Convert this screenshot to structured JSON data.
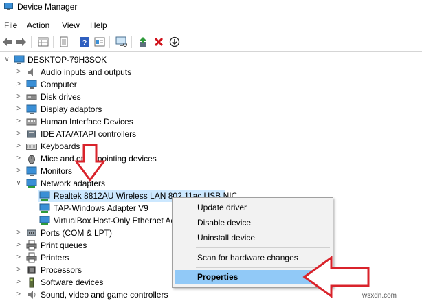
{
  "window": {
    "title": "Device Manager"
  },
  "menu": [
    "File",
    "Action",
    "View",
    "Help"
  ],
  "toolbar": {
    "icons": [
      "back-arrow-icon",
      "forward-arrow-icon",
      "properties-grid-icon",
      "update-list-icon",
      "help-icon",
      "device-details-icon",
      "monitor-scan-icon",
      "update-driver-icon",
      "uninstall-x-icon",
      "disable-download-icon"
    ]
  },
  "tree": {
    "root": "DESKTOP-79H3SOK",
    "items": [
      {
        "label": "Audio inputs and outputs",
        "icon": "speaker-icon",
        "expanded": false
      },
      {
        "label": "Computer",
        "icon": "computer-icon",
        "expanded": false
      },
      {
        "label": "Disk drives",
        "icon": "disk-drive-icon",
        "expanded": false
      },
      {
        "label": "Display adaptors",
        "icon": "display-adapter-icon",
        "expanded": false
      },
      {
        "label": "Human Interface Devices",
        "icon": "hid-icon",
        "expanded": false
      },
      {
        "label": "IDE ATA/ATAPI controllers",
        "icon": "ide-controller-icon",
        "expanded": false
      },
      {
        "label": "Keyboards",
        "icon": "keyboard-icon",
        "expanded": false
      },
      {
        "label": "Mice and other pointing devices",
        "icon": "mouse-icon",
        "expanded": false
      },
      {
        "label": "Monitors",
        "icon": "monitor-icon",
        "expanded": false
      },
      {
        "label": "Network adapters",
        "icon": "network-adapter-icon",
        "expanded": true
      },
      {
        "label": "Ports (COM & LPT)",
        "icon": "port-icon",
        "expanded": false
      },
      {
        "label": "Print queues",
        "icon": "print-queue-icon",
        "expanded": false
      },
      {
        "label": "Printers",
        "icon": "printer-icon",
        "expanded": false
      },
      {
        "label": "Processors",
        "icon": "processor-icon",
        "expanded": false
      },
      {
        "label": "Software devices",
        "icon": "software-device-icon",
        "expanded": false
      },
      {
        "label": "Sound, video and game controllers",
        "icon": "sound-controller-icon",
        "expanded": false
      }
    ],
    "network_children": [
      {
        "label": "Realtek 8812AU Wireless LAN 802.11ac USB NIC",
        "selected": true
      },
      {
        "label": "TAP-Windows Adapter V9",
        "selected": false
      },
      {
        "label": "VirtualBox Host-Only Ethernet Adapter",
        "selected": false
      }
    ]
  },
  "context_menu": {
    "items": [
      "Update driver",
      "Disable device",
      "Uninstall device",
      "Scan for hardware changes",
      "Properties"
    ],
    "highlighted": "Properties"
  },
  "annotations": [
    "red-arrow-down-icon",
    "red-arrow-left-icon"
  ],
  "watermark": "wsxdn.com",
  "colors": {
    "selection": "#cce8ff",
    "menu_highlight": "#91c9f7",
    "arrow": "#d9232b"
  }
}
